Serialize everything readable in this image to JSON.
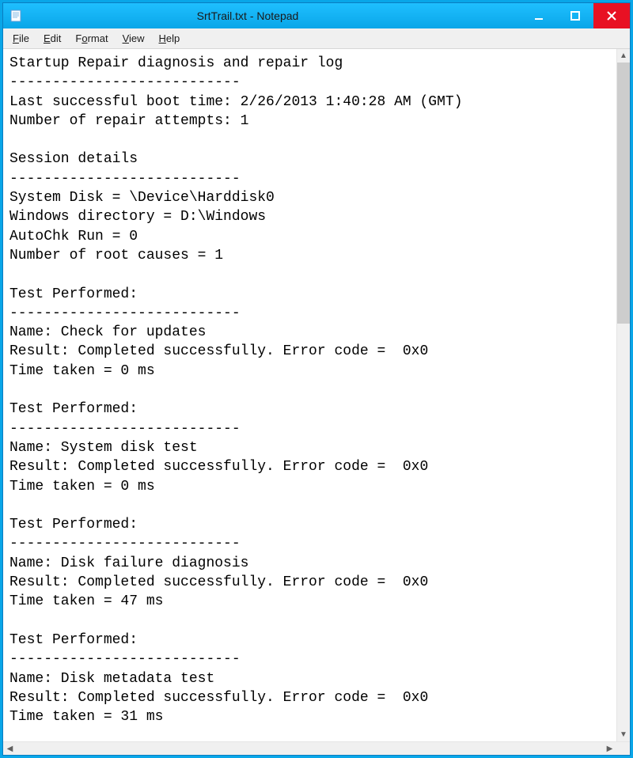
{
  "window": {
    "title": "SrtTrail.txt - Notepad"
  },
  "menubar": {
    "file": "File",
    "edit": "Edit",
    "format": "Format",
    "view": "View",
    "help": "Help"
  },
  "document": {
    "text": "Startup Repair diagnosis and repair log\n---------------------------\nLast successful boot time: 2/26/2013 1:40:28 AM (GMT)\nNumber of repair attempts: 1\n\nSession details\n---------------------------\nSystem Disk = \\Device\\Harddisk0\nWindows directory = D:\\Windows\nAutoChk Run = 0\nNumber of root causes = 1\n\nTest Performed:\n---------------------------\nName: Check for updates\nResult: Completed successfully. Error code =  0x0\nTime taken = 0 ms\n\nTest Performed:\n---------------------------\nName: System disk test\nResult: Completed successfully. Error code =  0x0\nTime taken = 0 ms\n\nTest Performed:\n---------------------------\nName: Disk failure diagnosis\nResult: Completed successfully. Error code =  0x0\nTime taken = 47 ms\n\nTest Performed:\n---------------------------\nName: Disk metadata test\nResult: Completed successfully. Error code =  0x0\nTime taken = 31 ms"
  }
}
